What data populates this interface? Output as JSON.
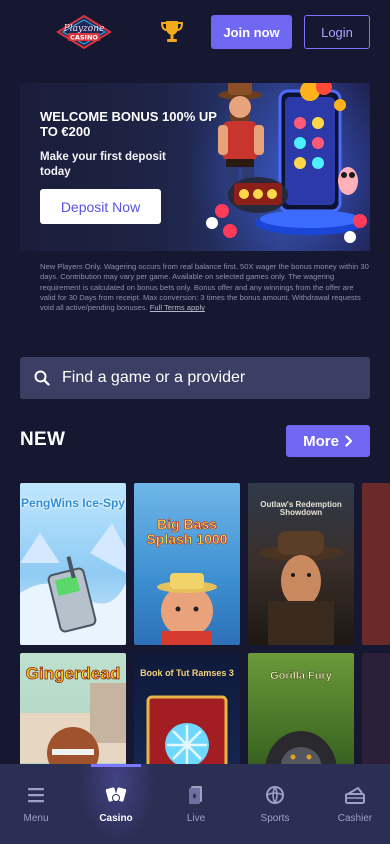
{
  "header": {
    "logo_text": "Playzone CASINO",
    "join_label": "Join now",
    "login_label": "Login"
  },
  "banner": {
    "title": "WELCOME BONUS 100% UP TO €200",
    "subtitle": "Make your first deposit today",
    "cta_label": "Deposit Now"
  },
  "terms": {
    "text": "New Players Only. Wagering occurs from real balance first. 50X wager the bonus money within 30 days. Contribution may vary per game. Available on selected games only. The wagering requirement is calculated on bonus bets only. Bonus offer and any winnings from the offer are valid for 30 Days from receipt. Max conversion: 3 times the bonus amount. Withdrawal requests void all active/pending bonuses.",
    "link_label": "Full Terms apply"
  },
  "search": {
    "placeholder": "Find a game or a provider"
  },
  "new_section": {
    "title": "NEW",
    "more_label": "More"
  },
  "games": [
    {
      "name": "PengWins Ice-Spy"
    },
    {
      "name": "Big Bass Splash 1000"
    },
    {
      "name": "Outlaw's Redemption Showdown"
    },
    {
      "name": "Gingerdead"
    },
    {
      "name": "Book of Tut Ramses 3"
    },
    {
      "name": "Gorilla Fury"
    }
  ],
  "bottom_nav": [
    {
      "label": "Menu",
      "icon": "menu-icon"
    },
    {
      "label": "Casino",
      "icon": "casino-cards-icon",
      "active": true
    },
    {
      "label": "Live",
      "icon": "live-cards-icon"
    },
    {
      "label": "Sports",
      "icon": "sports-ball-icon"
    },
    {
      "label": "Cashier",
      "icon": "cashier-icon"
    }
  ],
  "colors": {
    "background": "#161831",
    "accent": "#7068f2",
    "nav_background": "#2b2f54",
    "search_background": "#3a3f63"
  }
}
